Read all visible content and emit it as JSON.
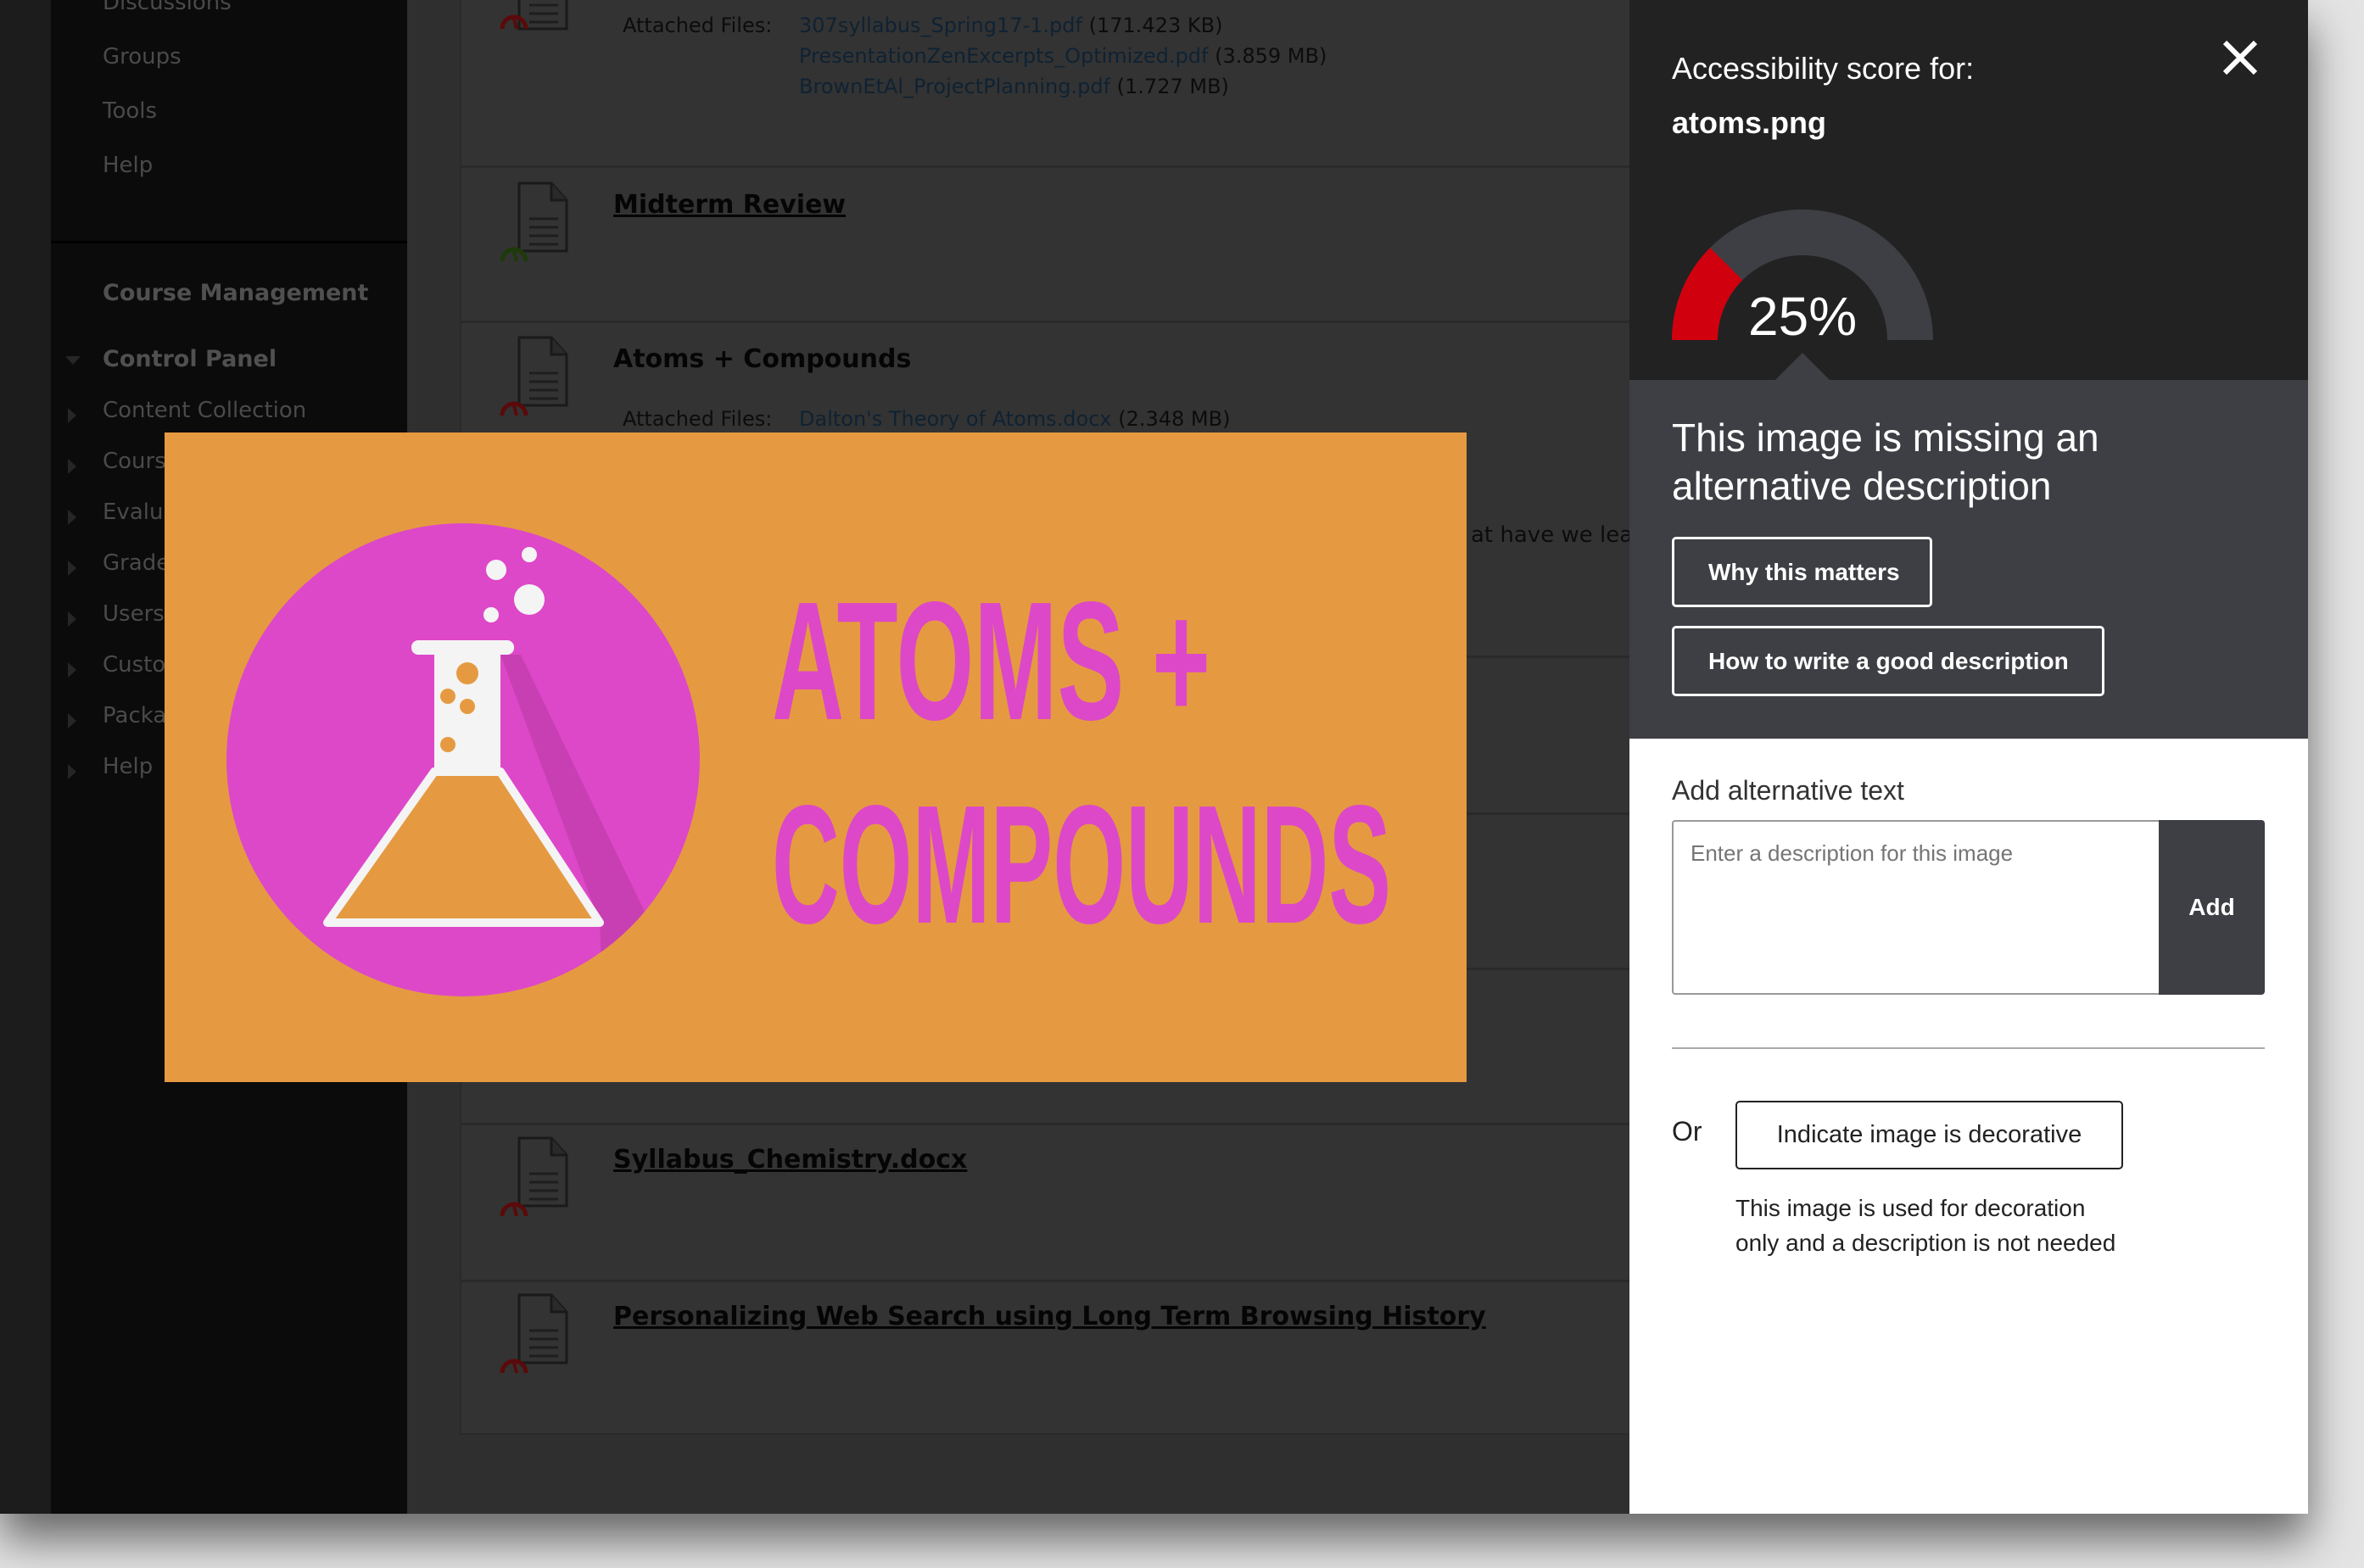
{
  "sidebar": {
    "top_items": [
      "Discussions",
      "Groups",
      "Tools",
      "Help"
    ],
    "section_title": "Course Management",
    "control_panel": "Control Panel",
    "control_items": [
      "Content Collection",
      "Cours",
      "Evalua",
      "Grade",
      "Users",
      "Custo",
      "Packa",
      "Help"
    ]
  },
  "content": {
    "attached_label": "Attached Files:",
    "top_files": [
      {
        "name": "307syllabus_Spring17-1.pdf",
        "size": "(171.423 KB)"
      },
      {
        "name": "PresentationZenExcerpts_Optimized.pdf",
        "size": "(3.859 MB)"
      },
      {
        "name": "BrownEtAl_ProjectPlanning.pdf",
        "size": "(1.727 MB)"
      }
    ],
    "items": [
      {
        "title": "Midterm Review",
        "status": "green"
      },
      {
        "title": "Atoms + Compounds",
        "status": "red"
      },
      {
        "title": "Syllabus_Chemistry.docx",
        "status": "red"
      },
      {
        "title": "Personalizing Web Search using Long Term Browsing History",
        "status": "red"
      }
    ],
    "atoms_file": {
      "name": "Dalton's Theory of Atoms.docx",
      "size": "(2.348 MB)"
    },
    "clipped_text": "at have we lear"
  },
  "image_preview": {
    "line1": "ATOMS +",
    "line2": "COMPOUNDS",
    "colors": {
      "background": "#e59a41",
      "circle": "#dd48c8",
      "text": "#dd48c8"
    }
  },
  "panel": {
    "score_label": "Accessibility score for:",
    "filename": "atoms.png",
    "score_percent": 25,
    "score_text": "25%",
    "message": "This image is missing an alternative description",
    "why_button": "Why this matters",
    "how_button": "How to write a good description",
    "alt_label": "Add alternative text",
    "alt_placeholder": "Enter a description for this image",
    "add_button": "Add",
    "or_label": "Or",
    "decorative_button": "Indicate image is decorative",
    "decorative_help": "This image is used for decoration only and a description is not needed",
    "colors": {
      "score_fill": "#d0000e",
      "score_track": "#3e3f44"
    }
  }
}
